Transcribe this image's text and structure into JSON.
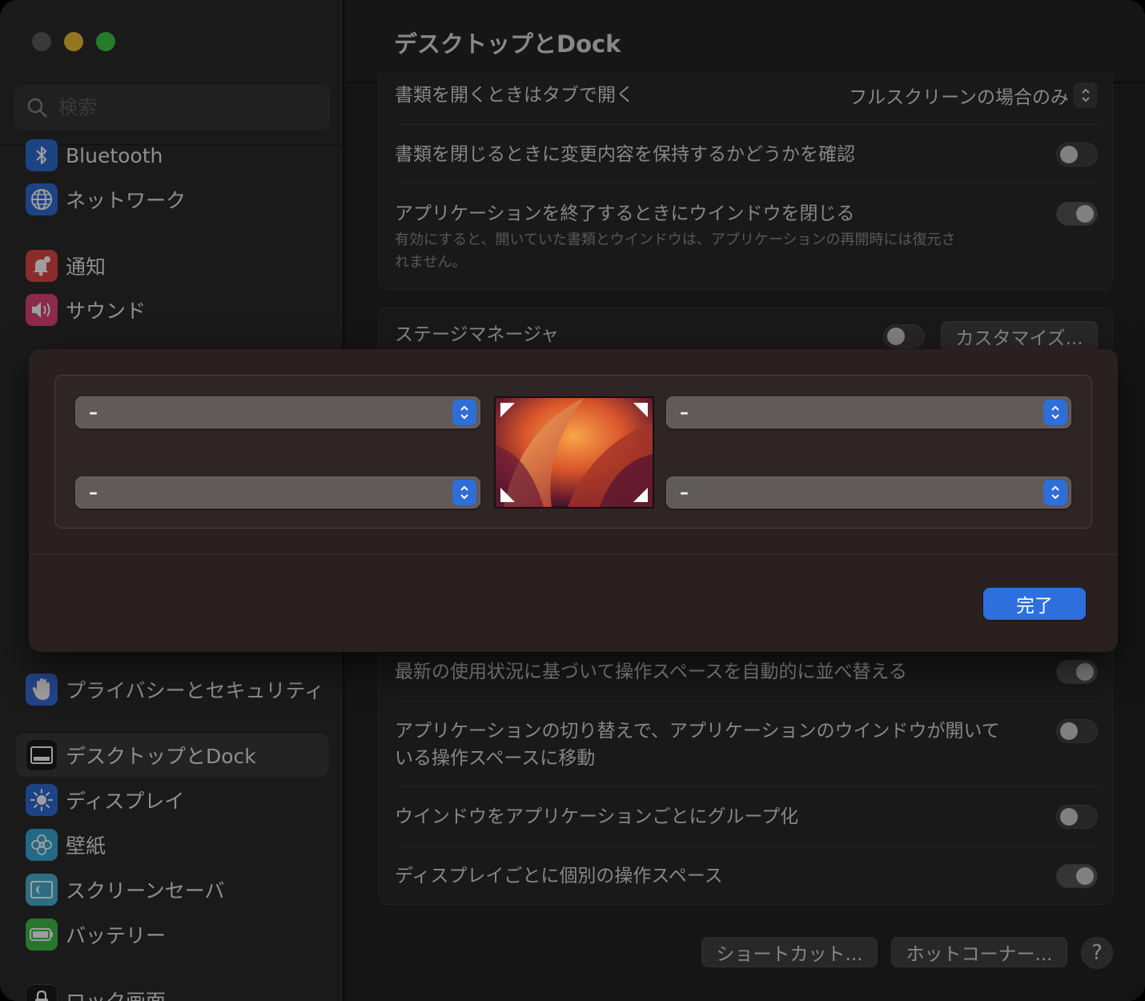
{
  "window": {
    "title": "デスクトップとDock"
  },
  "search": {
    "placeholder": "検索"
  },
  "sidebar": {
    "items": [
      {
        "label": "Bluetooth",
        "icon": "bluetooth-icon",
        "color": "#2f6cd6"
      },
      {
        "label": "ネットワーク",
        "icon": "globe-icon",
        "color": "#2f6cd6"
      },
      {
        "label": "通知",
        "icon": "bell-icon",
        "color": "#e04646"
      },
      {
        "label": "サウンド",
        "icon": "speaker-icon",
        "color": "#e0457a"
      },
      {
        "label": "プライバシーとセキュリティ",
        "icon": "hand-icon",
        "color": "#3a6fe0"
      },
      {
        "label": "デスクトップとDock",
        "icon": "dock-icon",
        "color": "#1b1b1b",
        "active": true
      },
      {
        "label": "ディスプレイ",
        "icon": "sun-icon",
        "color": "#2f6cd6"
      },
      {
        "label": "壁紙",
        "icon": "flower-icon",
        "color": "#39a9d6"
      },
      {
        "label": "スクリーンセーバ",
        "icon": "screensaver-icon",
        "color": "#48b2d4"
      },
      {
        "label": "バッテリー",
        "icon": "battery-icon",
        "color": "#3fbf4a"
      },
      {
        "label": "ロック画面",
        "icon": "lock-icon",
        "color": "#1b1b1b"
      }
    ]
  },
  "settings": {
    "tabs_row": {
      "label": "書類を開くときはタブで開く",
      "value": "フルスクリーンの場合のみ"
    },
    "confirm_row": {
      "label": "書類を閉じるときに変更内容を保持するかどうかを確認"
    },
    "close_windows_row": {
      "label": "アプリケーションを終了するときにウインドウを閉じる",
      "sub_line1": "有効にすると、開いていた書類とウインドウは、アプリケーションの再開時には復元さ",
      "sub_line2": "れません。"
    },
    "stage_manager": {
      "label": "ステージマネージャ",
      "customize": "カスタマイズ..."
    },
    "auto_rearrange": {
      "label": "最新の使用状況に基づいて操作スペースを自動的に並べ替える"
    },
    "switch_space": {
      "line1": "アプリケーションの切り替えで、アプリケーションのウインドウが開いて",
      "line2": "いる操作スペースに移動"
    },
    "group_windows": {
      "label": "ウインドウをアプリケーションごとにグループ化"
    },
    "separate_spaces": {
      "label": "ディスプレイごとに個別の操作スペース"
    }
  },
  "footer": {
    "shortcuts": "ショートカット...",
    "hot_corners": "ホットコーナー...",
    "help": "?"
  },
  "hot_corners_sheet": {
    "top_left": "–",
    "top_right": "–",
    "bottom_left": "–",
    "bottom_right": "–",
    "done": "完了"
  },
  "colors": {
    "accent": "#2d6fdc",
    "window_bg": "#242222",
    "sheet_bg": "#2a2020"
  }
}
